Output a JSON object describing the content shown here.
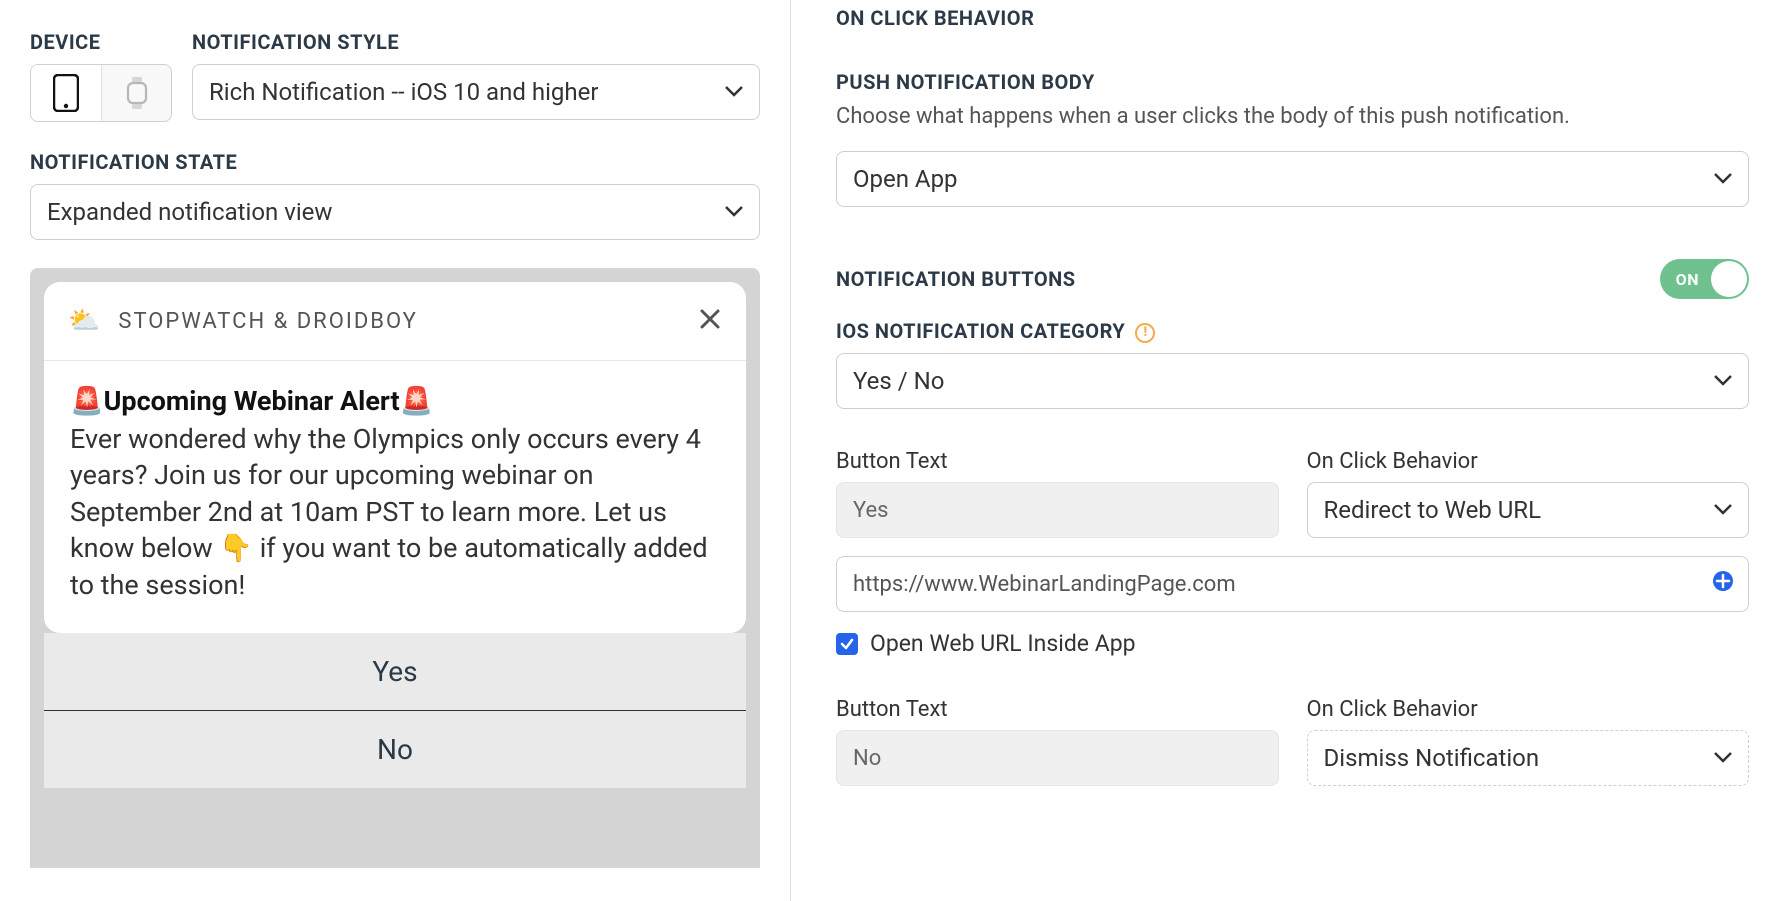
{
  "left": {
    "device_label": "DEVICE",
    "style_label": "NOTIFICATION STYLE",
    "style_value": "Rich Notification -- iOS 10 and higher",
    "state_label": "NOTIFICATION STATE",
    "state_value": "Expanded notification view",
    "preview": {
      "app_icon": "⛅",
      "app_name": "STOPWATCH & DROIDBOY",
      "title": "🚨Upcoming Webinar Alert🚨",
      "body": "Ever wondered why the Olympics only occurs every 4 years? Join us for our upcoming webinar on September 2nd at 10am PST to learn more. Let us know below 👇 if you want to be automatically added to the session!",
      "actions": [
        "Yes",
        "No"
      ]
    }
  },
  "right": {
    "on_click_header": "ON CLICK BEHAVIOR",
    "push_body_label": "PUSH NOTIFICATION BODY",
    "push_body_help": "Choose what happens when a user clicks the body of this push notification.",
    "push_body_value": "Open App",
    "notif_buttons_label": "NOTIFICATION BUTTONS",
    "toggle_label": "ON",
    "ios_category_label": "IOS NOTIFICATION CATEGORY",
    "ios_category_value": "Yes / No",
    "btn1": {
      "text_label": "Button Text",
      "text_value": "Yes",
      "behavior_label": "On Click Behavior",
      "behavior_value": "Redirect to Web URL",
      "url_value": "https://www.WebinarLandingPage.com",
      "open_inside_label": "Open Web URL Inside App"
    },
    "btn2": {
      "text_label": "Button Text",
      "text_value": "No",
      "behavior_label": "On Click Behavior",
      "behavior_value": "Dismiss Notification"
    }
  }
}
